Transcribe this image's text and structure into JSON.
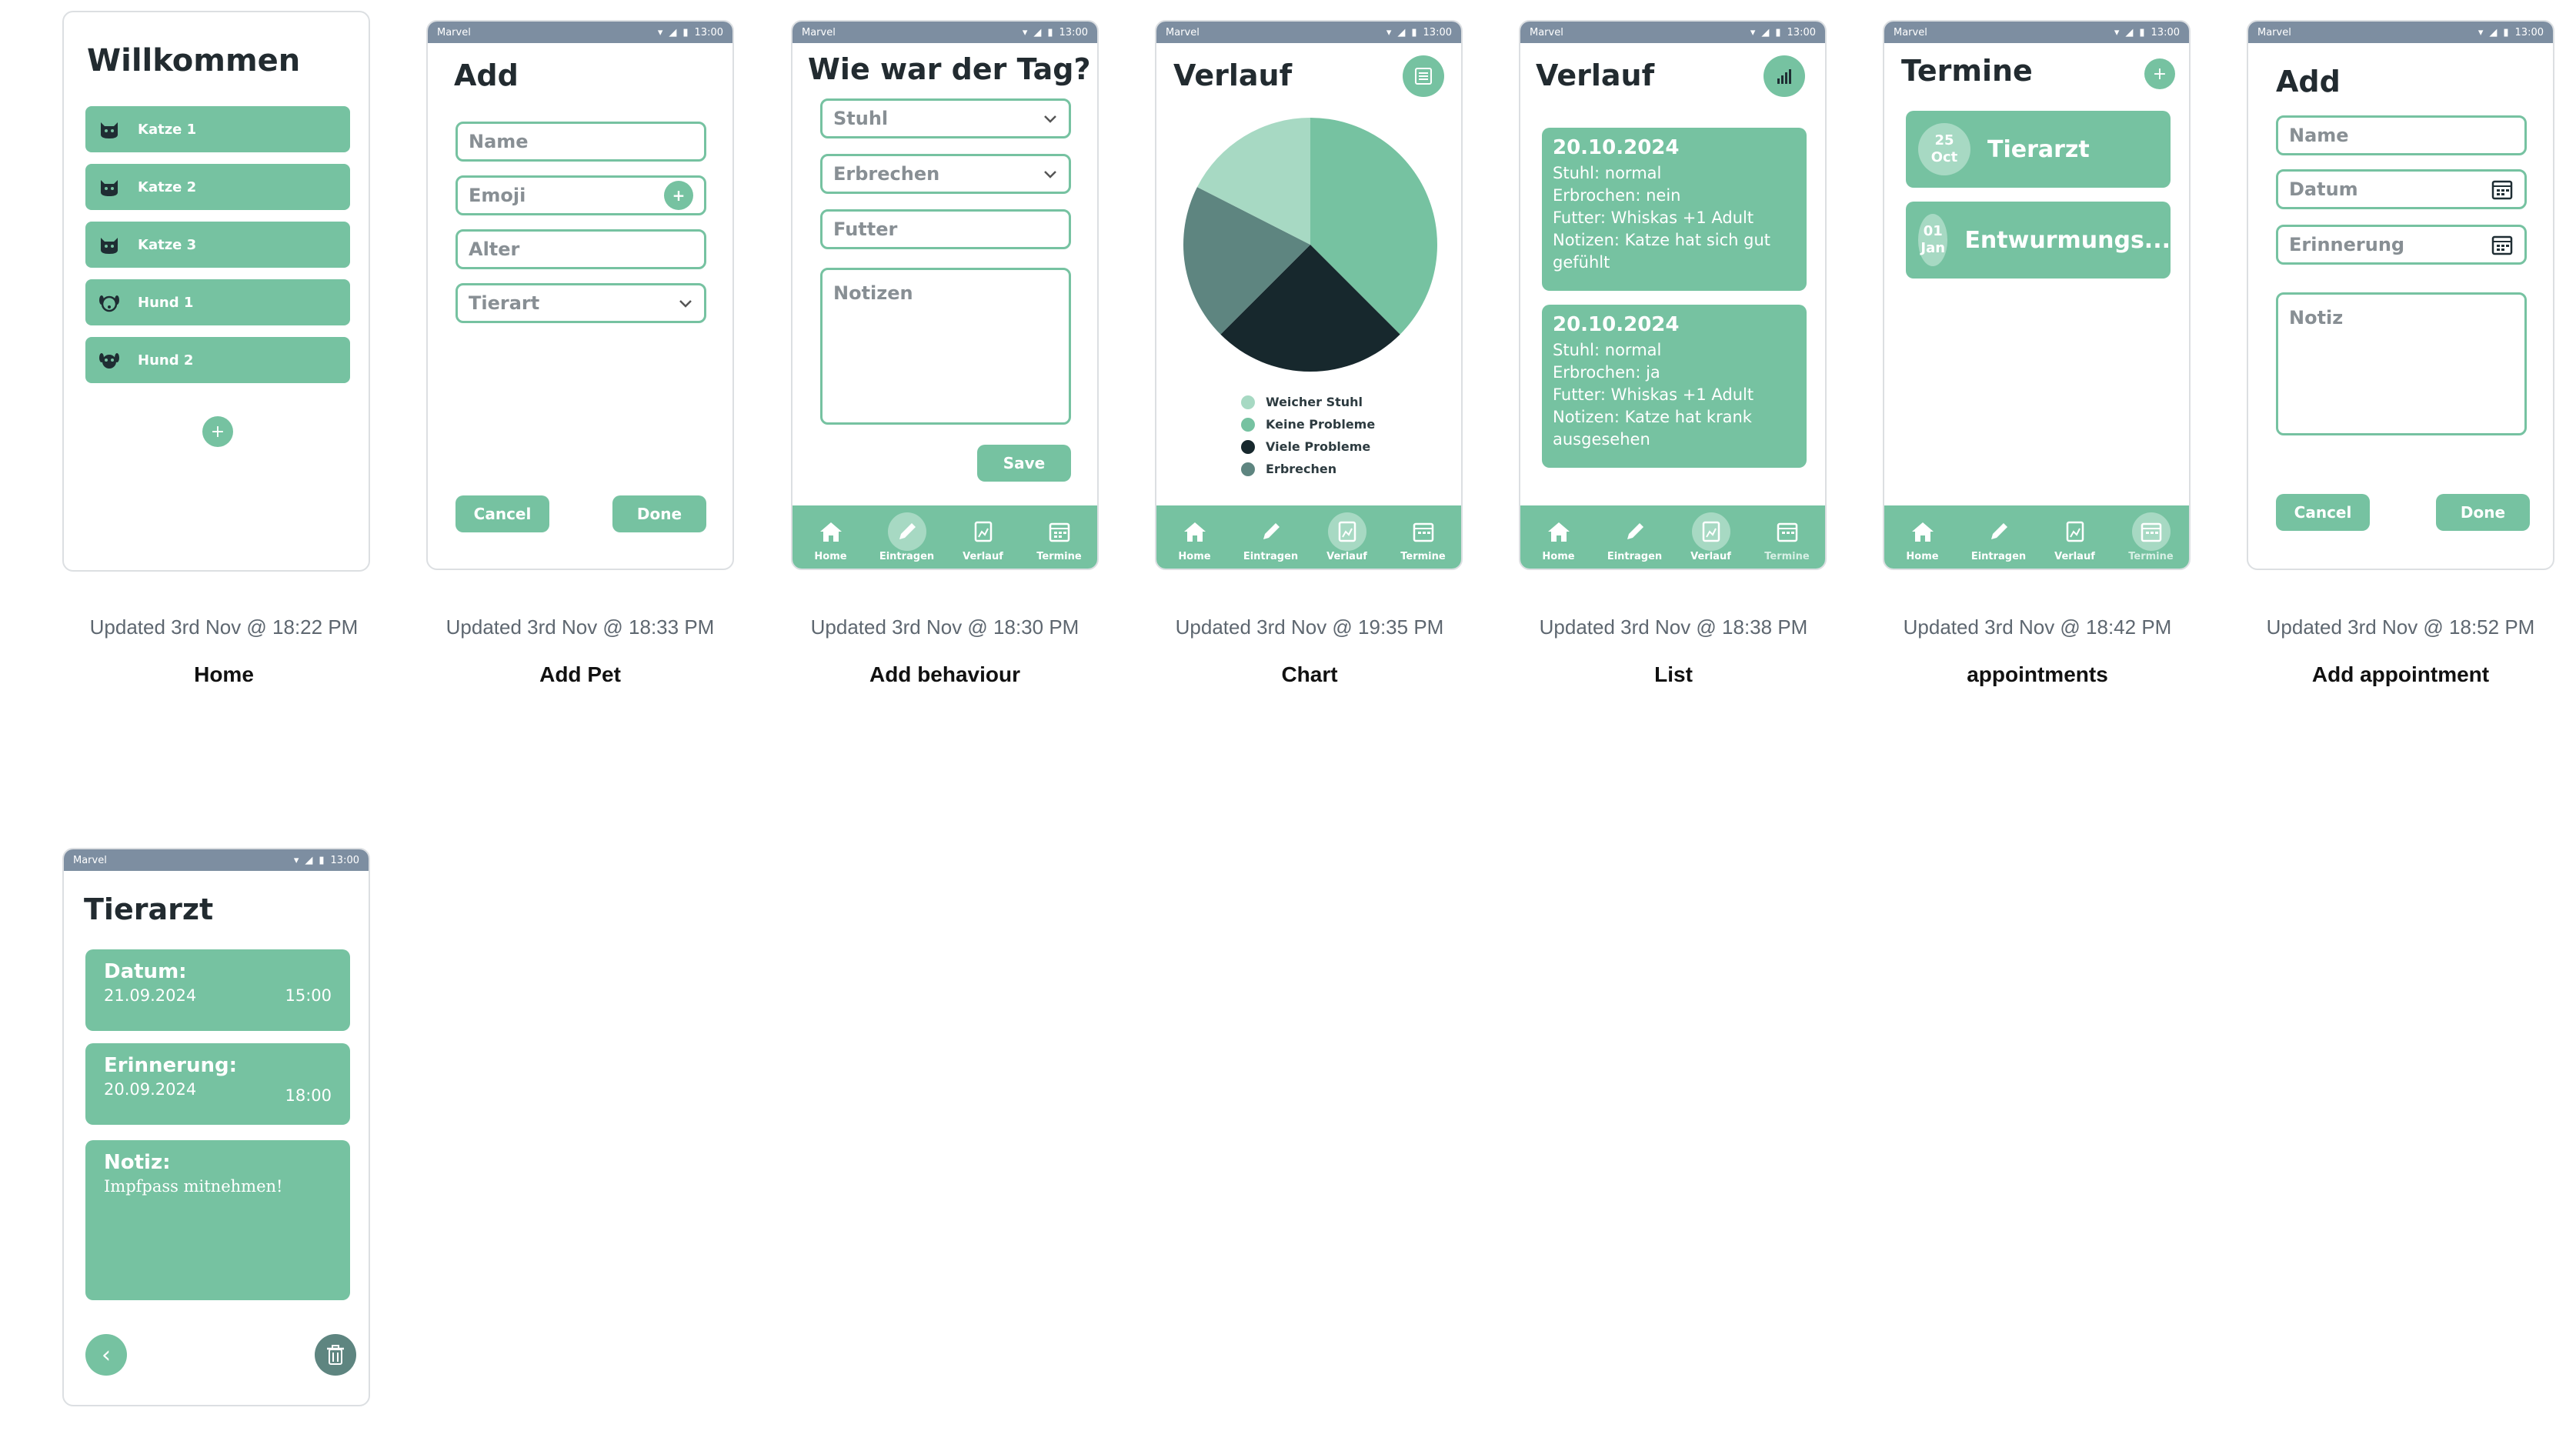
{
  "status_bar": {
    "carrier": "Marvel",
    "time": "13:00"
  },
  "colors": {
    "primary": "#76c2a1",
    "light": "#a7d9c3",
    "dark": "#17282d",
    "slate": "#5e8580",
    "statusbar": "#7d8ea1"
  },
  "nav": {
    "home": "Home",
    "eintragen": "Eintragen",
    "verlauf": "Verlauf",
    "termine": "Termine"
  },
  "screens": {
    "home": {
      "title": "Willkommen",
      "pets": [
        {
          "label": "Katze 1",
          "icon": "cat-icon"
        },
        {
          "label": "Katze 2",
          "icon": "cat-icon"
        },
        {
          "label": "Katze 3",
          "icon": "cat-icon"
        },
        {
          "label": "Hund 1",
          "icon": "dog-icon"
        },
        {
          "label": "Hund 2",
          "icon": "dog-icon"
        }
      ],
      "add_label": "+",
      "updated": "Updated 3rd Nov @ 18:22 PM",
      "name": "Home"
    },
    "add_pet": {
      "title": "Add",
      "name_placeholder": "Name",
      "emoji_placeholder": "Emoji",
      "emoji_add": "+",
      "age_placeholder": "Alter",
      "species_placeholder": "Tierart",
      "cancel": "Cancel",
      "done": "Done",
      "updated": "Updated 3rd Nov @ 18:33 PM",
      "name": "Add Pet"
    },
    "add_behaviour": {
      "title": "Wie war der Tag?",
      "stool": "Stuhl",
      "vomit": "Erbrechen",
      "food": "Futter",
      "notes": "Notizen",
      "save": "Save",
      "updated": "Updated 3rd Nov @ 18:30 PM",
      "name": "Add behaviour"
    },
    "chart": {
      "title": "Verlauf",
      "updated": "Updated 3rd Nov @ 19:35 PM",
      "name": "Chart"
    },
    "list": {
      "title": "Verlauf",
      "entries": [
        {
          "date": "20.10.2024",
          "lines": [
            "Stuhl: normal",
            "Erbrochen: nein",
            "Futter: Whiskas +1 Adult",
            "Notizen: Katze hat sich gut gefühlt"
          ]
        },
        {
          "date": "20.10.2024",
          "lines": [
            "Stuhl: normal",
            "Erbrochen: ja",
            "Futter: Whiskas +1 Adult",
            "Notizen: Katze hat krank ausgesehen"
          ]
        }
      ],
      "updated": "Updated 3rd Nov @ 18:38 PM",
      "name": "List"
    },
    "appointments": {
      "title": "Termine",
      "add_label": "+",
      "items": [
        {
          "day": "25",
          "month": "Oct",
          "label": "Tierarzt"
        },
        {
          "day": "01",
          "month": "Jan",
          "label": "Entwurmungs..."
        }
      ],
      "updated": "Updated 3rd Nov @ 18:42 PM",
      "name": "appointments"
    },
    "add_appointment": {
      "title": "Add",
      "name_placeholder": "Name",
      "date_placeholder": "Datum",
      "reminder_placeholder": "Erinnerung",
      "note_placeholder": "Notiz",
      "cancel": "Cancel",
      "done": "Done",
      "updated": "Updated 3rd Nov @ 18:52 PM",
      "name": "Add appointment"
    },
    "appointment_detail": {
      "title": "Tierarzt",
      "date_label": "Datum:",
      "date_value": "21.09.2024",
      "date_time": "15:00",
      "reminder_label": "Erinnerung:",
      "reminder_value": "20.09.2024",
      "reminder_time": "18:00",
      "note_label": "Notiz:",
      "note_value": "Impfpass mitnehmen!",
      "back": "‹"
    }
  },
  "chart_data": {
    "type": "pie",
    "slices": [
      {
        "name": "Keine Probleme",
        "value": 37.5,
        "color": "#76c2a1"
      },
      {
        "name": "Viele Probleme",
        "value": 25,
        "color": "#17282d"
      },
      {
        "name": "Erbrechen",
        "value": 20,
        "color": "#5e8580"
      },
      {
        "name": "Weicher Stuhl",
        "value": 17.5,
        "color": "#a7d9c3"
      }
    ],
    "legend": [
      "Weicher Stuhl",
      "Keine Probleme",
      "Viele Probleme",
      "Erbrechen"
    ],
    "legend_colors": [
      "#a7d9c3",
      "#76c2a1",
      "#17282d",
      "#5e8580"
    ]
  }
}
